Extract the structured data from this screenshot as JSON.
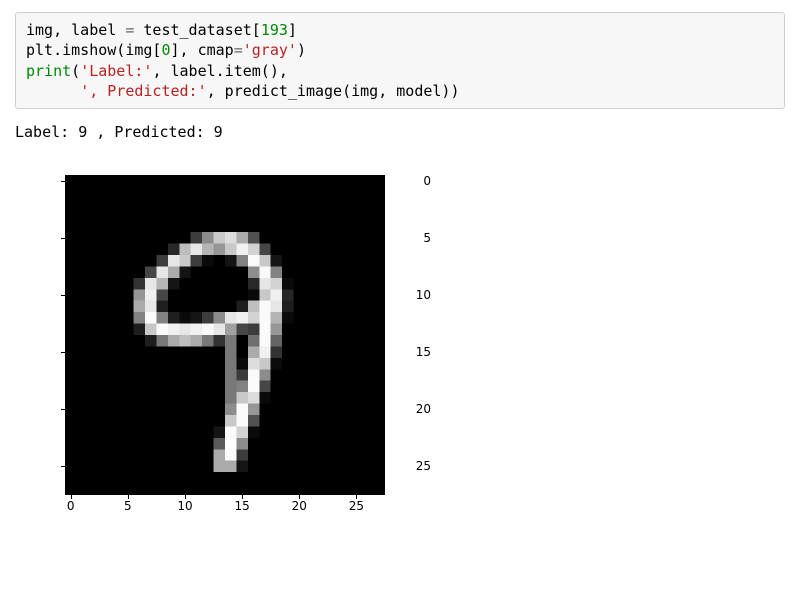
{
  "code": {
    "l1_pre": "img, label ",
    "l1_eq": "=",
    "l1_mid": " test_dataset[",
    "l1_idx": "193",
    "l1_post": "]",
    "l2_pre": "plt.imshow(img[",
    "l2_zero": "0",
    "l2_mid": "], cmap",
    "l2_eq": "=",
    "l2_str": "'gray'",
    "l2_post": ")",
    "l3_kw": "print",
    "l3_open": "(",
    "l3_str1": "'Label:'",
    "l3_mid": ", label.item(),",
    "l4_pad": "      ",
    "l4_str2": "', Predicted:'",
    "l4_post": ", predict_image(img, model))"
  },
  "output_text": "Label: 9 , Predicted: 9",
  "chart_data": {
    "type": "heatmap",
    "title": "",
    "xlabel": "",
    "ylabel": "",
    "xlim": [
      -0.5,
      27.5
    ],
    "ylim": [
      27.5,
      -0.5
    ],
    "xticks": [
      0,
      5,
      10,
      15,
      20,
      25
    ],
    "yticks": [
      0,
      5,
      10,
      15,
      20,
      25
    ],
    "cmap": "gray",
    "shape": [
      28,
      28
    ],
    "values": [
      [
        0,
        0,
        0,
        0,
        0,
        0,
        0,
        0,
        0,
        0,
        0,
        0,
        0,
        0,
        0,
        0,
        0,
        0,
        0,
        0,
        0,
        0,
        0,
        0,
        0,
        0,
        0,
        0
      ],
      [
        0,
        0,
        0,
        0,
        0,
        0,
        0,
        0,
        0,
        0,
        0,
        0,
        0,
        0,
        0,
        0,
        0,
        0,
        0,
        0,
        0,
        0,
        0,
        0,
        0,
        0,
        0,
        0
      ],
      [
        0,
        0,
        0,
        0,
        0,
        0,
        0,
        0,
        0,
        0,
        0,
        0,
        0,
        0,
        0,
        0,
        0,
        0,
        0,
        0,
        0,
        0,
        0,
        0,
        0,
        0,
        0,
        0
      ],
      [
        0,
        0,
        0,
        0,
        0,
        0,
        0,
        0,
        0,
        0,
        0,
        0,
        0,
        0,
        0,
        0,
        0,
        0,
        0,
        0,
        0,
        0,
        0,
        0,
        0,
        0,
        0,
        0
      ],
      [
        0,
        0,
        0,
        0,
        0,
        0,
        0,
        0,
        0,
        0,
        0,
        0,
        0,
        0,
        0,
        0,
        0,
        0,
        0,
        0,
        0,
        0,
        0,
        0,
        0,
        0,
        0,
        0
      ],
      [
        0,
        0,
        0,
        0,
        0,
        0,
        0,
        0,
        0,
        0,
        0,
        60,
        140,
        200,
        220,
        170,
        80,
        0,
        0,
        0,
        0,
        0,
        0,
        0,
        0,
        0,
        0,
        0
      ],
      [
        0,
        0,
        0,
        0,
        0,
        0,
        0,
        0,
        0,
        40,
        190,
        230,
        180,
        150,
        200,
        240,
        210,
        70,
        0,
        0,
        0,
        0,
        0,
        0,
        0,
        0,
        0,
        0
      ],
      [
        0,
        0,
        0,
        0,
        0,
        0,
        0,
        0,
        60,
        230,
        200,
        60,
        10,
        0,
        20,
        130,
        250,
        200,
        20,
        0,
        0,
        0,
        0,
        0,
        0,
        0,
        0,
        0
      ],
      [
        0,
        0,
        0,
        0,
        0,
        0,
        0,
        70,
        230,
        170,
        20,
        0,
        0,
        0,
        0,
        0,
        140,
        250,
        130,
        0,
        0,
        0,
        0,
        0,
        0,
        0,
        0,
        0
      ],
      [
        0,
        0,
        0,
        0,
        0,
        0,
        50,
        230,
        180,
        20,
        0,
        0,
        0,
        0,
        0,
        0,
        40,
        230,
        210,
        10,
        0,
        0,
        0,
        0,
        0,
        0,
        0,
        0
      ],
      [
        0,
        0,
        0,
        0,
        0,
        0,
        150,
        240,
        70,
        0,
        0,
        0,
        0,
        0,
        0,
        0,
        10,
        200,
        240,
        40,
        0,
        0,
        0,
        0,
        0,
        0,
        0,
        0
      ],
      [
        0,
        0,
        0,
        0,
        0,
        0,
        170,
        230,
        30,
        0,
        0,
        0,
        0,
        0,
        0,
        30,
        190,
        250,
        230,
        30,
        0,
        0,
        0,
        0,
        0,
        0,
        0,
        0
      ],
      [
        0,
        0,
        0,
        0,
        0,
        0,
        130,
        250,
        130,
        30,
        10,
        20,
        60,
        140,
        230,
        240,
        210,
        250,
        180,
        10,
        0,
        0,
        0,
        0,
        0,
        0,
        0,
        0
      ],
      [
        0,
        0,
        0,
        0,
        0,
        0,
        30,
        200,
        250,
        240,
        230,
        240,
        250,
        230,
        160,
        70,
        60,
        250,
        150,
        0,
        0,
        0,
        0,
        0,
        0,
        0,
        0,
        0
      ],
      [
        0,
        0,
        0,
        0,
        0,
        0,
        0,
        30,
        120,
        170,
        190,
        170,
        120,
        50,
        120,
        0,
        110,
        250,
        100,
        0,
        0,
        0,
        0,
        0,
        0,
        0,
        0,
        0
      ],
      [
        0,
        0,
        0,
        0,
        0,
        0,
        0,
        0,
        0,
        0,
        0,
        0,
        0,
        0,
        120,
        0,
        170,
        240,
        50,
        0,
        0,
        0,
        0,
        0,
        0,
        0,
        0,
        0
      ],
      [
        0,
        0,
        0,
        0,
        0,
        0,
        0,
        0,
        0,
        0,
        0,
        0,
        0,
        0,
        120,
        10,
        220,
        200,
        10,
        0,
        0,
        0,
        0,
        0,
        0,
        0,
        0,
        0
      ],
      [
        0,
        0,
        0,
        0,
        0,
        0,
        0,
        0,
        0,
        0,
        0,
        0,
        0,
        0,
        120,
        60,
        250,
        140,
        0,
        0,
        0,
        0,
        0,
        0,
        0,
        0,
        0,
        0
      ],
      [
        0,
        0,
        0,
        0,
        0,
        0,
        0,
        0,
        0,
        0,
        0,
        0,
        0,
        0,
        120,
        130,
        250,
        70,
        0,
        0,
        0,
        0,
        0,
        0,
        0,
        0,
        0,
        0
      ],
      [
        0,
        0,
        0,
        0,
        0,
        0,
        0,
        0,
        0,
        0,
        0,
        0,
        0,
        0,
        120,
        200,
        220,
        10,
        0,
        0,
        0,
        0,
        0,
        0,
        0,
        0,
        0,
        0
      ],
      [
        0,
        0,
        0,
        0,
        0,
        0,
        0,
        0,
        0,
        0,
        0,
        0,
        0,
        0,
        140,
        250,
        150,
        0,
        0,
        0,
        0,
        0,
        0,
        0,
        0,
        0,
        0,
        0
      ],
      [
        0,
        0,
        0,
        0,
        0,
        0,
        0,
        0,
        0,
        0,
        0,
        0,
        0,
        0,
        200,
        250,
        80,
        0,
        0,
        0,
        0,
        0,
        0,
        0,
        0,
        0,
        0,
        0
      ],
      [
        0,
        0,
        0,
        0,
        0,
        0,
        0,
        0,
        0,
        0,
        0,
        0,
        0,
        20,
        250,
        210,
        10,
        0,
        0,
        0,
        0,
        0,
        0,
        0,
        0,
        0,
        0,
        0
      ],
      [
        0,
        0,
        0,
        0,
        0,
        0,
        0,
        0,
        0,
        0,
        0,
        0,
        0,
        90,
        255,
        140,
        0,
        0,
        0,
        0,
        0,
        0,
        0,
        0,
        0,
        0,
        0,
        0
      ],
      [
        0,
        0,
        0,
        0,
        0,
        0,
        0,
        0,
        0,
        0,
        0,
        0,
        0,
        170,
        250,
        60,
        0,
        0,
        0,
        0,
        0,
        0,
        0,
        0,
        0,
        0,
        0,
        0
      ],
      [
        0,
        0,
        0,
        0,
        0,
        0,
        0,
        0,
        0,
        0,
        0,
        0,
        0,
        170,
        170,
        20,
        0,
        0,
        0,
        0,
        0,
        0,
        0,
        0,
        0,
        0,
        0,
        0
      ],
      [
        0,
        0,
        0,
        0,
        0,
        0,
        0,
        0,
        0,
        0,
        0,
        0,
        0,
        0,
        0,
        0,
        0,
        0,
        0,
        0,
        0,
        0,
        0,
        0,
        0,
        0,
        0,
        0
      ],
      [
        0,
        0,
        0,
        0,
        0,
        0,
        0,
        0,
        0,
        0,
        0,
        0,
        0,
        0,
        0,
        0,
        0,
        0,
        0,
        0,
        0,
        0,
        0,
        0,
        0,
        0,
        0,
        0
      ]
    ]
  }
}
